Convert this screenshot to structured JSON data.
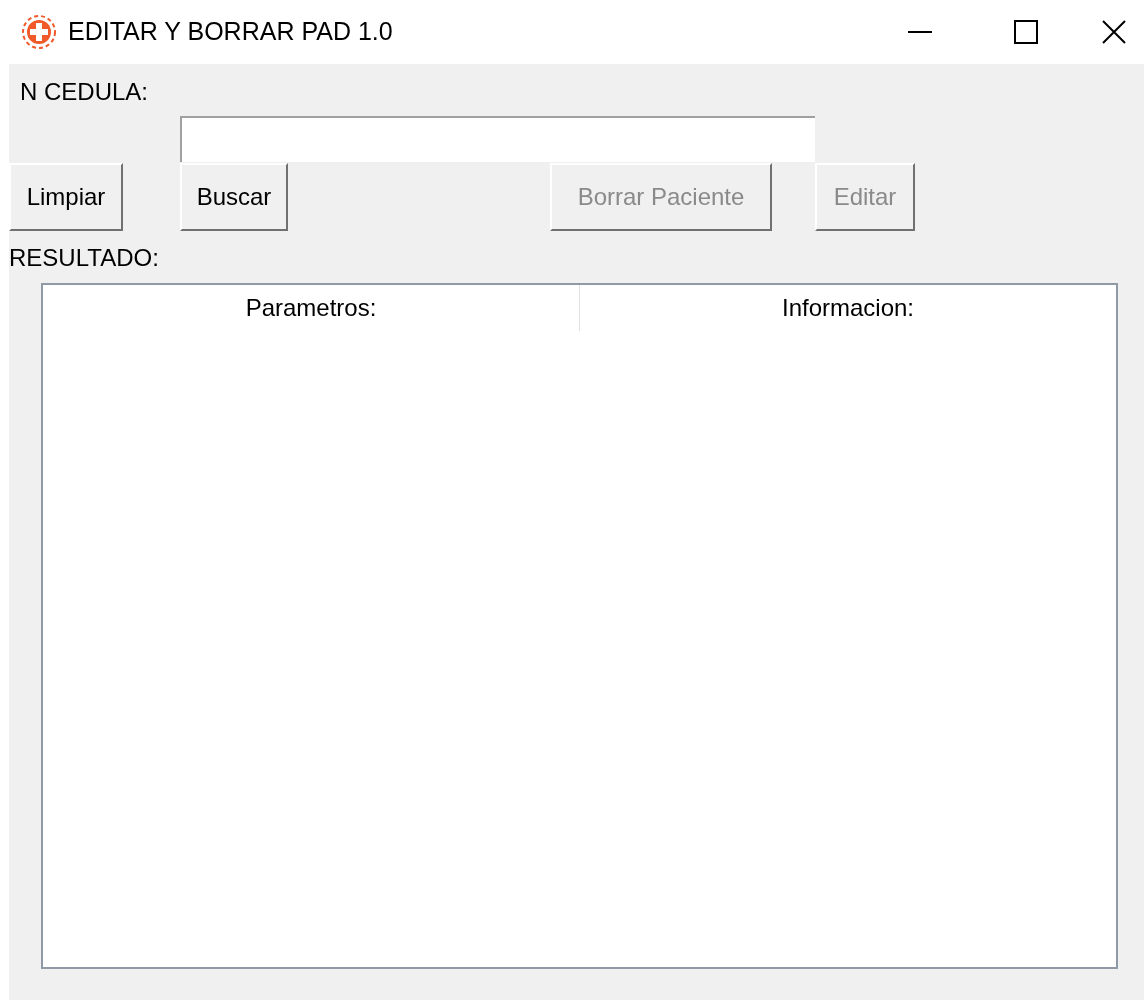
{
  "window": {
    "title": "EDITAR Y BORRAR PAD 1.0"
  },
  "cedula_label": "N CEDULA:",
  "buttons": [
    {
      "label": "Limpiar",
      "disabled": false
    },
    {
      "label": "Buscar",
      "disabled": false
    },
    {
      "label": "Borrar Paciente",
      "disabled": true
    },
    {
      "label": "Editar",
      "disabled": true
    }
  ],
  "result_label": "RESULTADO:",
  "table": {
    "columns": [
      "Parametros:",
      "Informacion:"
    ]
  }
}
